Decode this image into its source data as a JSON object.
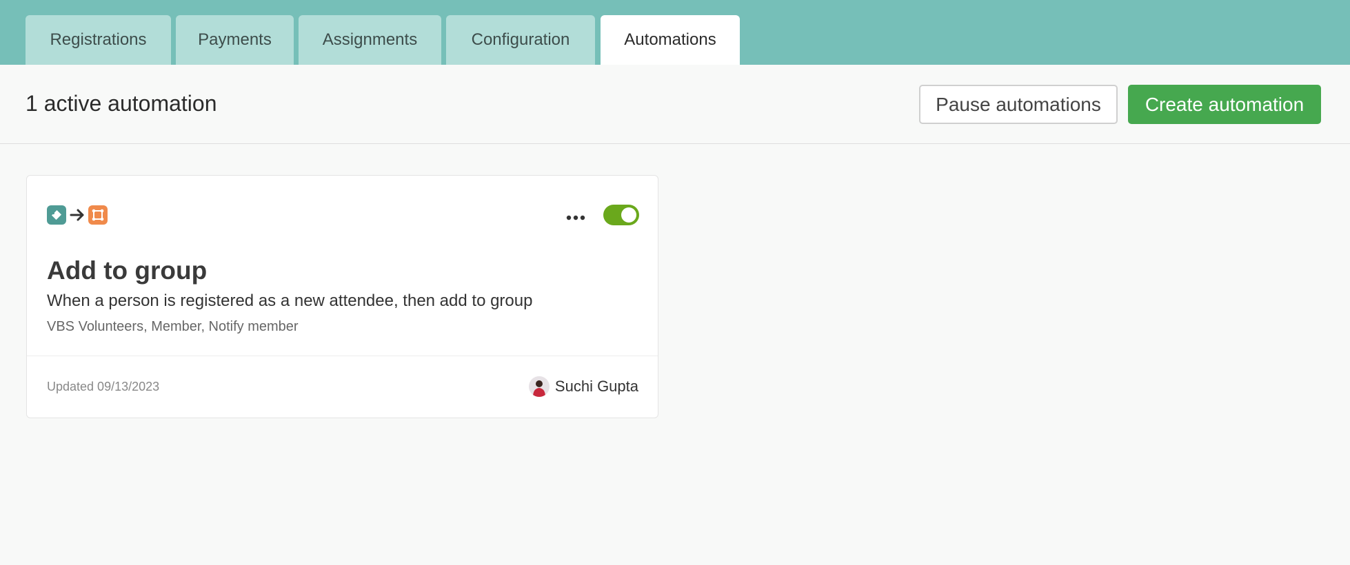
{
  "tabs": [
    {
      "label": "Registrations",
      "active": false
    },
    {
      "label": "Payments",
      "active": false
    },
    {
      "label": "Assignments",
      "active": false
    },
    {
      "label": "Configuration",
      "active": false
    },
    {
      "label": "Automations",
      "active": true
    }
  ],
  "header": {
    "title": "1 active automation",
    "pause_label": "Pause automations",
    "create_label": "Create automation"
  },
  "automation": {
    "icons": [
      "ticket-icon",
      "arrow-right-icon",
      "group-icon"
    ],
    "enabled": true,
    "title": "Add to group",
    "description": "When a person is registered as a new attendee, then add to group",
    "details": "VBS Volunteers, Member, Notify member",
    "updated": "Updated 09/13/2023",
    "owner": "Suchi Gupta"
  },
  "colors": {
    "tabbar": "#76bfb8",
    "primary_button": "#46a84f",
    "toggle_on": "#6aa81c",
    "trigger_icon": "#4f9b95",
    "action_icon": "#f08a4b"
  }
}
